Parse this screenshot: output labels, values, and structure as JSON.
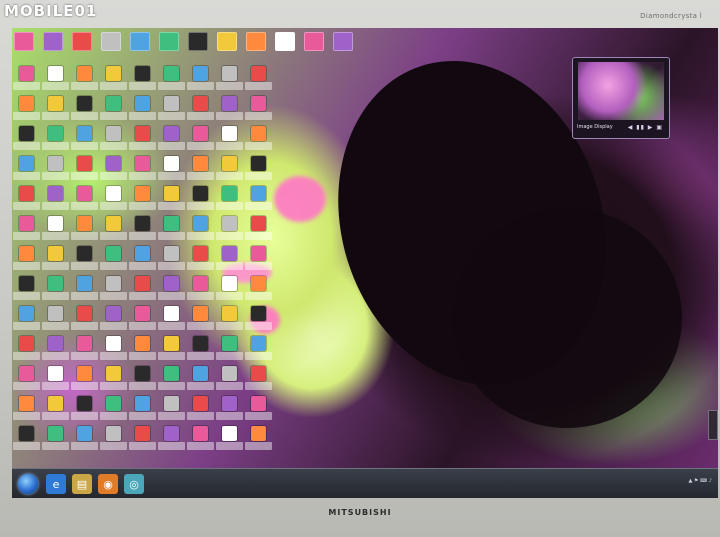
{
  "bezel": {
    "watermark": "MOBILE01",
    "top_label": "Diamondcrysta l",
    "brand": "MITSUBISHI",
    "button_labels": [
      "",
      "",
      "",
      ""
    ]
  },
  "gadget": {
    "title": "Image Display",
    "controls": "◀ ▮▮ ▶ ▣"
  },
  "taskbar": {
    "pinned": [
      {
        "name": "ie-icon",
        "glyph": "e",
        "color": "#2f7ad7"
      },
      {
        "name": "explorer-icon",
        "glyph": "▤",
        "color": "#c9a646"
      },
      {
        "name": "firefox-icon",
        "glyph": "◉",
        "color": "#e07b28"
      },
      {
        "name": "media-icon",
        "glyph": "◎",
        "color": "#4aa6b8"
      }
    ],
    "tray_text": "▲  ⚑  ⌨  ♪"
  },
  "colors": {
    "accent_pink": "#ff77c6",
    "accent_green": "#cfe86e",
    "accent_purple": "#8d3b86"
  }
}
